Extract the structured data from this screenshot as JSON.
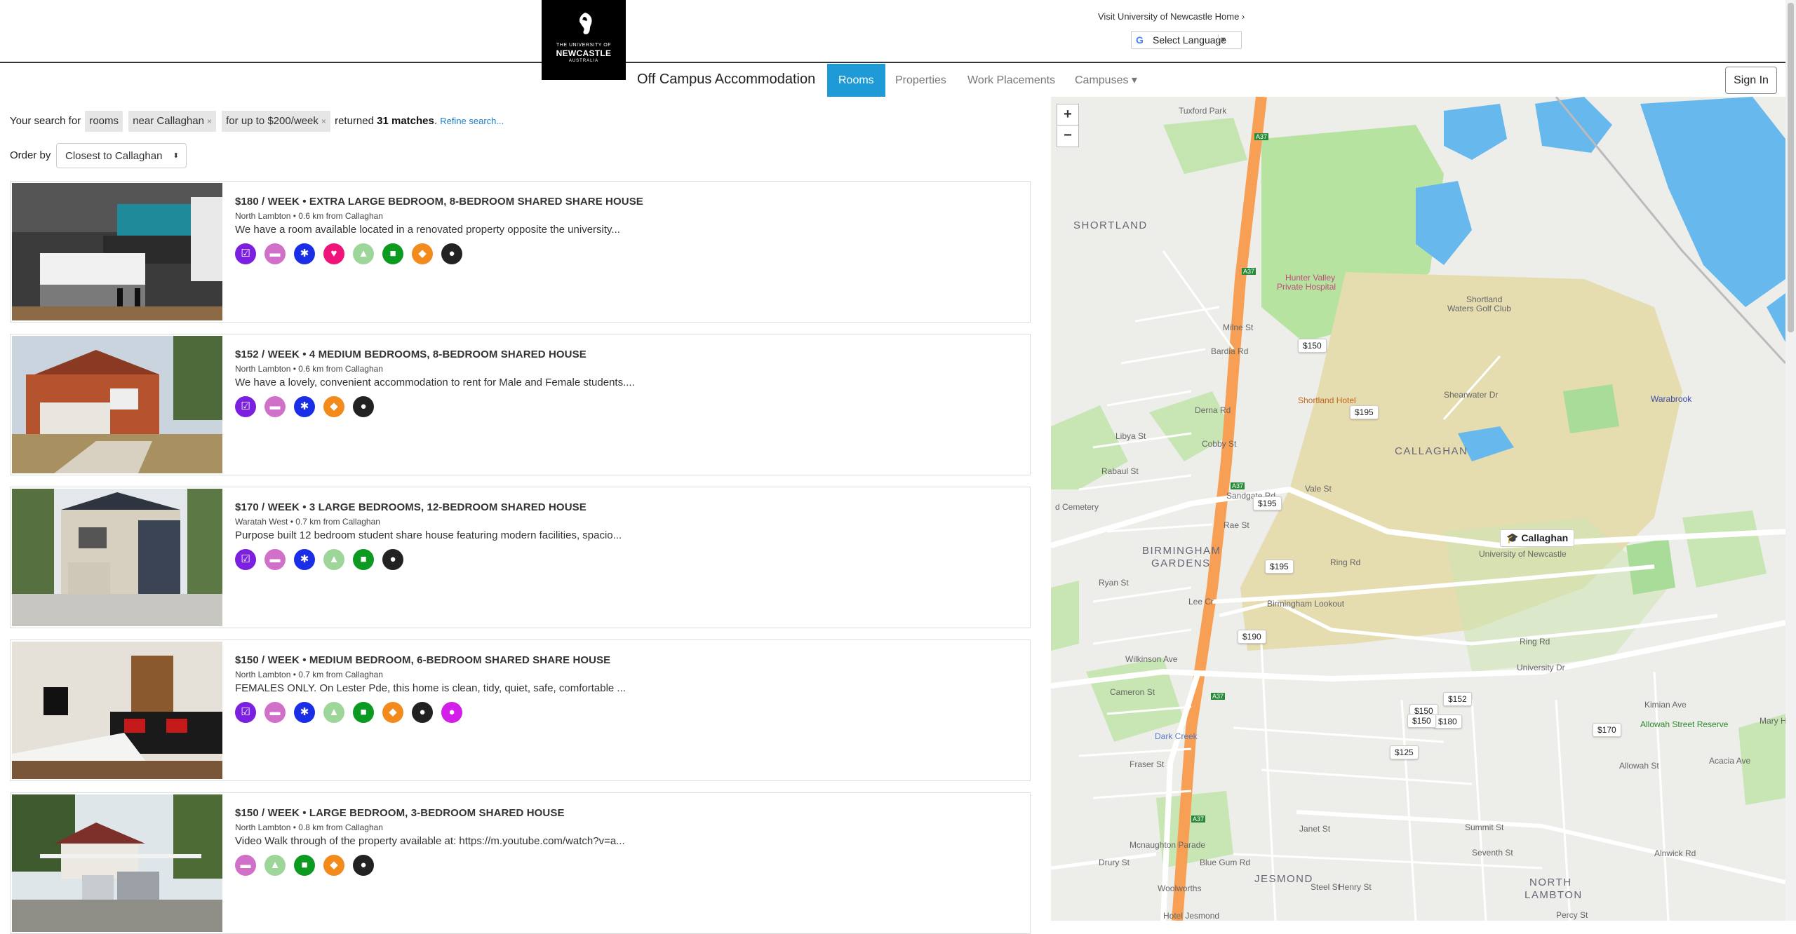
{
  "header": {
    "logo": {
      "line1": "THE UNIVERSITY OF",
      "line2": "NEWCASTLE",
      "line3": "AUSTRALIA"
    },
    "visit_link": "Visit University of Newcastle Home ›",
    "language_select": {
      "label": "Select Language",
      "arrow": "▼",
      "g": "G"
    },
    "site_title": "Off Campus Accommodation",
    "nav": [
      {
        "label": "Rooms",
        "active": true
      },
      {
        "label": "Properties",
        "active": false
      },
      {
        "label": "Work Placements",
        "active": false
      },
      {
        "label": "Campuses ▾",
        "active": false
      }
    ],
    "signin": "Sign In"
  },
  "search": {
    "prefix": "Your search for",
    "chips": [
      "rooms",
      "near Callaghan",
      "for up to $200/week"
    ],
    "chip_close": [
      "",
      "×",
      "×"
    ],
    "returned": "returned",
    "matches": "31 matches",
    "period": ".",
    "refine": "Refine search..."
  },
  "order": {
    "label": "Order by",
    "value": "Closest to Callaghan",
    "caret": "⬍"
  },
  "listings": [
    {
      "title": "$180 / WEEK • EXTRA LARGE BEDROOM, 8-BEDROOM SHARED SHARE HOUSE",
      "location": "North Lambton • 0.6 km from Callaghan",
      "description": "We have a room available located in a renovated property opposite the university...",
      "features": [
        "checkbox",
        "bed",
        "asterisk",
        "heart",
        "grad",
        "bus",
        "cart",
        "pin"
      ]
    },
    {
      "title": "$152 / WEEK • 4 MEDIUM BEDROOMS, 8-BEDROOM SHARED HOUSE",
      "location": "North Lambton • 0.6 km from Callaghan",
      "description": "We have a lovely, convenient accommodation to rent for Male and Female students....",
      "features": [
        "checkbox",
        "bed",
        "asterisk",
        "cart",
        "pin"
      ]
    },
    {
      "title": "$170 / WEEK • 3 LARGE BEDROOMS, 12-BEDROOM SHARED HOUSE",
      "location": "Waratah West • 0.7 km from Callaghan",
      "description": "Purpose built 12 bedroom student share house featuring modern facilities, spacio...",
      "features": [
        "checkbox",
        "bed",
        "asterisk",
        "grad",
        "bus",
        "pin"
      ]
    },
    {
      "title": "$150 / WEEK • MEDIUM BEDROOM, 6-BEDROOM SHARED SHARE HOUSE",
      "location": "North Lambton • 0.7 km from Callaghan",
      "description": "FEMALES ONLY. On Lester Pde, this home is clean, tidy, quiet, safe, comfortable ...",
      "features": [
        "checkbox",
        "bed",
        "asterisk",
        "grad",
        "bus",
        "cart",
        "pin",
        "female"
      ]
    },
    {
      "title": "$150 / WEEK • LARGE BEDROOM, 3-BEDROOM SHARED HOUSE",
      "location": "North Lambton • 0.8 km from Callaghan",
      "description": "Video Walk through of the property available at: https://m.youtube.com/watch?v=a...",
      "features": [
        "bed",
        "grad",
        "bus",
        "cart",
        "pin"
      ]
    }
  ],
  "feature_icons": {
    "checkbox": {
      "glyph": "☑",
      "color": "#7b1fe0"
    },
    "bed": {
      "glyph": "▬",
      "color": "#d070c8"
    },
    "asterisk": {
      "glyph": "✱",
      "color": "#1a2ee8"
    },
    "heart": {
      "glyph": "♥",
      "color": "#f0147a"
    },
    "grad": {
      "glyph": "▲",
      "color": "#9ed69a"
    },
    "bus": {
      "glyph": "■",
      "color": "#0c9a20"
    },
    "cart": {
      "glyph": "◆",
      "color": "#f28a1c"
    },
    "pin": {
      "glyph": "●",
      "color": "#222222"
    },
    "female": {
      "glyph": "●",
      "color": "#d21ee8"
    }
  },
  "map": {
    "zoom_in": "+",
    "zoom_out": "−",
    "price_markers": [
      "$150",
      "$195",
      "$195",
      "$195",
      "$190",
      "$152",
      "$150",
      "$180",
      "$125",
      "$170",
      "$150"
    ],
    "callaghan_marker": "🎓 Callaghan",
    "place_labels": {
      "shortland": "SHORTLAND",
      "callaghan": "CALLAGHAN",
      "birmingham1": "BIRMINGHAM",
      "birmingham2": "GARDENS",
      "jesmond": "JESMOND",
      "north1": "NORTH",
      "north2": "LAMBTON"
    },
    "small_labels": {
      "tuxford": "Tuxford Park",
      "hospital1": "Hunter Valley",
      "hospital2": "Private Hospital",
      "golf1": "Shortland",
      "golf2": "Waters Golf Club",
      "shortland_hotel": "Shortland Hotel",
      "warabrook": "Warabrook",
      "uni": "University of Newcastle",
      "cemetery": "d Cemetery",
      "lookout": "Birmingham Lookout",
      "allowah": "Allowah Street Reserve",
      "mary": "Mary Ho",
      "woolworths": "Woolworths",
      "hotel_jesmond": "Hotel Jesmond",
      "dark_creek": "Dark Creek",
      "milne": "Milne St",
      "bardia": "Bardia Rd",
      "derna": "Derna Rd",
      "libya": "Libya St",
      "rabaul": "Rabaul St",
      "cobby": "Cobby St",
      "sandgate": "Sandgate Rd",
      "vale": "Vale St",
      "rae": "Rae St",
      "ryan": "Ryan St",
      "lee": "Lee Cr",
      "wilkinson": "Wilkinson Ave",
      "cameron": "Cameron St",
      "fraser": "Fraser St",
      "ring1": "Ring Rd",
      "ring2": "Ring Rd",
      "univ_dr": "University Dr",
      "shearwater": "Shearwater Dr",
      "kimian": "Kimian Ave",
      "allowah_st": "Allowah St",
      "acacia": "Acacia Ave",
      "janet": "Janet St",
      "summit": "Summit St",
      "seventh": "Seventh St",
      "alnwick": "Alnwick Rd",
      "bluegum": "Blue Gum Rd",
      "drury": "Drury St",
      "mcnaughton": "Mcnaughton Parade",
      "henry": "Henry St",
      "steel": "Steel St",
      "percy": "Percy St",
      "a37_1": "A37",
      "a37_2": "A37",
      "a37_3": "A37",
      "a37_4": "A37",
      "a37_5": "A37"
    }
  }
}
